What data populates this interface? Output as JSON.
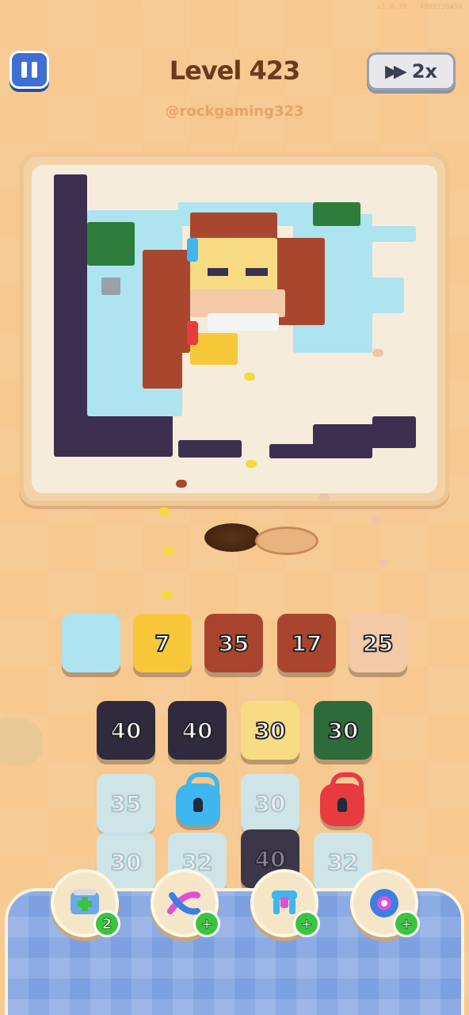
{
  "status": {
    "version_text": "v1.0.39 · 4908736454"
  },
  "header": {
    "level_title": "Level 423",
    "username": "@rockgaming323",
    "speed_label": "2x"
  },
  "conveyor": [
    {
      "value": "7",
      "color": "#f7c93a"
    },
    {
      "value": "35",
      "color": "#a9452f"
    },
    {
      "value": "17",
      "color": "#a9452f"
    },
    {
      "value": "25",
      "color": "#f3c9a8"
    }
  ],
  "grid_row1": [
    {
      "value": "40",
      "color": "#2f2a3e"
    },
    {
      "value": "40",
      "color": "#2f2a3e"
    },
    {
      "value": "30",
      "color": "#f8dc84"
    },
    {
      "value": "30",
      "color": "#2e6b3a"
    }
  ],
  "grid_row2": [
    {
      "value": "35",
      "type": "faded"
    },
    {
      "value": "",
      "type": "lock",
      "color": "#3fb6ee"
    },
    {
      "value": "30",
      "type": "faded"
    },
    {
      "value": "",
      "type": "lock",
      "color": "#e73b40"
    }
  ],
  "grid_row3": [
    {
      "value": "30",
      "type": "faded"
    },
    {
      "value": "32",
      "type": "faded"
    },
    {
      "value": "40",
      "type": "dark"
    },
    {
      "value": "32",
      "type": "faded"
    }
  ],
  "boosters": [
    {
      "icon": "add-slot-icon",
      "badge": "2"
    },
    {
      "icon": "shuffle-arrows-icon",
      "badge": "+"
    },
    {
      "icon": "magnet-claw-icon",
      "badge": "+"
    },
    {
      "icon": "donut-ring-icon",
      "badge": "+"
    }
  ]
}
